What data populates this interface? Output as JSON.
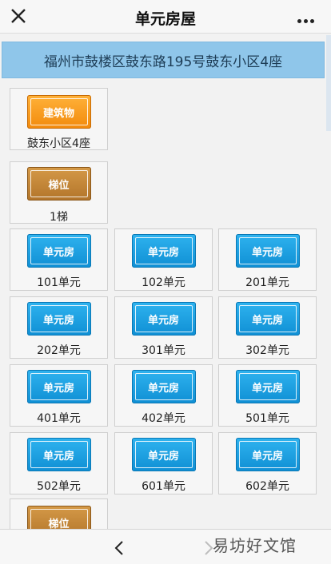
{
  "header": {
    "title": "单元房屋"
  },
  "address": "福州市鼓楼区鼓东路195号鼓东小区4座",
  "building": {
    "badge": "建筑物",
    "caption": "鼓东小区4座"
  },
  "stairs": [
    {
      "badge": "梯位",
      "caption": "1梯"
    },
    {
      "badge": "梯位",
      "caption": ""
    }
  ],
  "unit_badge": "单元房",
  "units": [
    "101单元",
    "102单元",
    "201单元",
    "202单元",
    "301单元",
    "302单元",
    "401单元",
    "402单元",
    "501单元",
    "502单元",
    "601单元",
    "602单元"
  ],
  "watermark": "易坊好文馆",
  "colors": {
    "address_bg": "#8fc6ea",
    "unit_blue": "#1aa2e3",
    "building_orange": "#f7991f",
    "stairs_bronze": "#c4873a"
  },
  "icons": {
    "close": "close-icon",
    "more": "more-icon",
    "back": "chevron-left-icon",
    "forward": "chevron-right-icon"
  }
}
